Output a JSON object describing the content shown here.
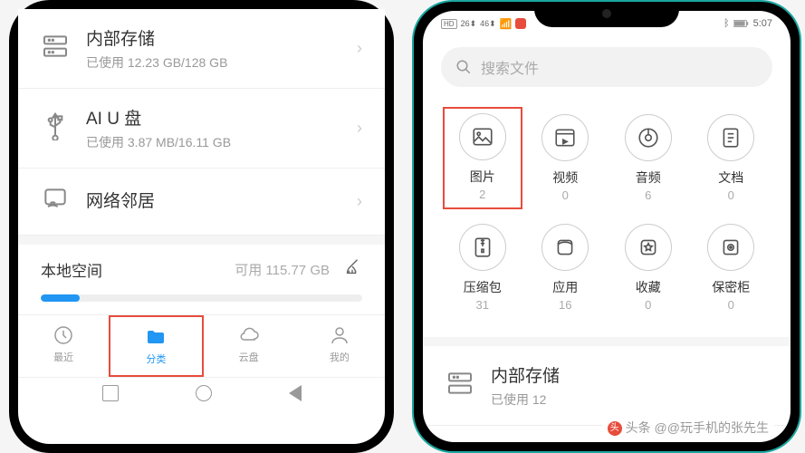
{
  "left": {
    "storage": [
      {
        "title": "内部存储",
        "subtitle": "已使用 12.23 GB/128 GB",
        "icon": "server"
      },
      {
        "title": "AI U 盘",
        "subtitle": "已使用 3.87 MB/16.11 GB",
        "icon": "usb"
      },
      {
        "title": "网络邻居",
        "subtitle": "",
        "icon": "network"
      }
    ],
    "local": {
      "label": "本地空间",
      "available": "可用 115.77 GB",
      "progress_pct": 12
    },
    "tabs": [
      {
        "label": "最近",
        "icon": "clock"
      },
      {
        "label": "分类",
        "icon": "folder",
        "active": true,
        "highlighted": true
      },
      {
        "label": "云盘",
        "icon": "cloud"
      },
      {
        "label": "我的",
        "icon": "person"
      }
    ]
  },
  "right": {
    "status_time": "5:07",
    "search_placeholder": "搜索文件",
    "categories": [
      {
        "label": "图片",
        "count": "2",
        "icon": "image",
        "highlighted": true
      },
      {
        "label": "视频",
        "count": "0",
        "icon": "video"
      },
      {
        "label": "音频",
        "count": "6",
        "icon": "audio"
      },
      {
        "label": "文档",
        "count": "0",
        "icon": "document"
      },
      {
        "label": "压缩包",
        "count": "31",
        "icon": "zip"
      },
      {
        "label": "应用",
        "count": "16",
        "icon": "app"
      },
      {
        "label": "收藏",
        "count": "0",
        "icon": "favorite"
      },
      {
        "label": "保密柜",
        "count": "0",
        "icon": "safe"
      }
    ],
    "storage": {
      "title": "内部存储",
      "subtitle": "已使用 12"
    },
    "watermark": "头条 @@玩手机的张先生"
  }
}
